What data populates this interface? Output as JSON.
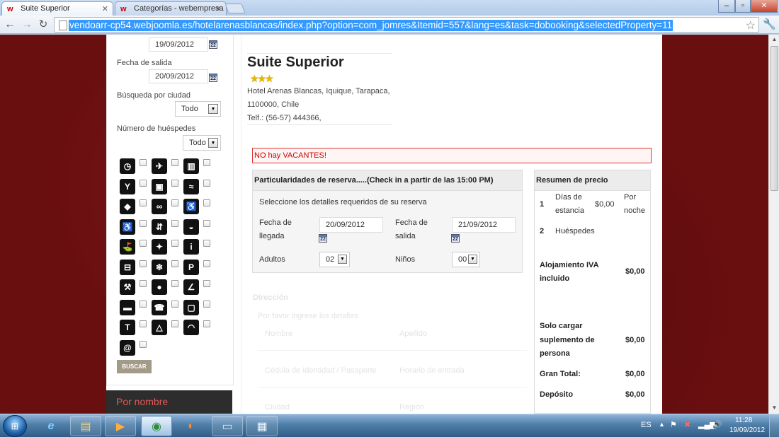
{
  "browser": {
    "tabs": [
      {
        "title": "Suite Superior",
        "active": true
      },
      {
        "title": "Categorías - webempresa",
        "active": false
      }
    ],
    "url": "vendoarr-cp54.webjoomla.es/hotelarenasblancas/index.php?option=com_jomres&Itemid=557&lang=es&task=dobooking&selectedProperty=11"
  },
  "sidebar": {
    "arrival_date": "19/09/2012",
    "departure_label": "Fecha de salida",
    "departure_date": "20/09/2012",
    "city_label": "Búsqueda por ciudad",
    "city_value": "Todo",
    "guests_label": "Número de huéspedes",
    "guests_value": "Todo",
    "search_button": "BUSCAR",
    "by_name_label": "Por nombre",
    "calendar_icon_text": "22",
    "feature_icons": [
      "clock-icon",
      "plane-icon",
      "heater-icon",
      "cocktail-icon",
      "tv-icon",
      "swimming-icon",
      "pet-icon",
      "bicycle-icon",
      "wheelchair-icon",
      "accessible-wc-icon",
      "elevator-icon",
      "baby-stroller-icon",
      "golf-icon",
      "hair-dryer-icon",
      "info-icon",
      "atm-icon",
      "snowflake-icon",
      "parking-icon",
      "gym-icon",
      "restaurant-icon",
      "shoe-icon",
      "bus-icon",
      "telephone-icon",
      "television-icon",
      "tour-icon",
      "beach-icon",
      "wifi-icon",
      "www-icon"
    ]
  },
  "property": {
    "title": "Suite Superior",
    "stars": "★★★",
    "address_line1": "Hotel Arenas Blancas, Iquique, Tarapaca,",
    "address_line2": "1100000, Chile",
    "phone": "Telf.: (56-57) 444366,"
  },
  "alert": "NO hay VACANTES!",
  "booking": {
    "header": "Particularidades de reserva.....(Check in a partir de las 15:00 PM)",
    "instructions": "Seleccione los detalles requeridos de su reserva",
    "arrival_label_1": "Fecha de",
    "arrival_label_2": "llegada",
    "arrival_value": "20/09/2012",
    "departure_label_1": "Fecha de",
    "departure_label_2": "salida",
    "departure_value": "21/09/2012",
    "adults_label": "Adultos",
    "adults_value": "02",
    "children_label": "Niños",
    "children_value": "00"
  },
  "address_form": {
    "section": "Dirección",
    "hint": "Por favor ingrese los detalles",
    "name": "Nombre",
    "surname": "Apellido",
    "id_card": "Cédula de Identidad / Pasaporte",
    "arrival_time": "Horario de entrada",
    "city": "Ciudad",
    "region": "Región"
  },
  "price_summary": {
    "header": "Resumen de precio",
    "row1_num": "1",
    "row1_label_1": "Días de",
    "row1_label_2": "estancia",
    "row1_value": "$0,00",
    "row1_unit_1": "Por",
    "row1_unit_2": "noche",
    "row2_num": "2",
    "row2_label": "Huéspedes",
    "lodging_label_1": "Alojamiento IVA",
    "lodging_label_2": "incluido",
    "lodging_value": "$0,00",
    "supplement_label_1": "Solo cargar",
    "supplement_label_2": "suplemento de",
    "supplement_label_3": "persona",
    "supplement_value": "$0,00",
    "total_label": "Gran Total:",
    "total_value": "$0,00",
    "deposit_label": "Depósito",
    "deposit_value": "$0,00"
  },
  "taskbar": {
    "language": "ES",
    "time": "11:28",
    "date": "19/09/2012"
  }
}
